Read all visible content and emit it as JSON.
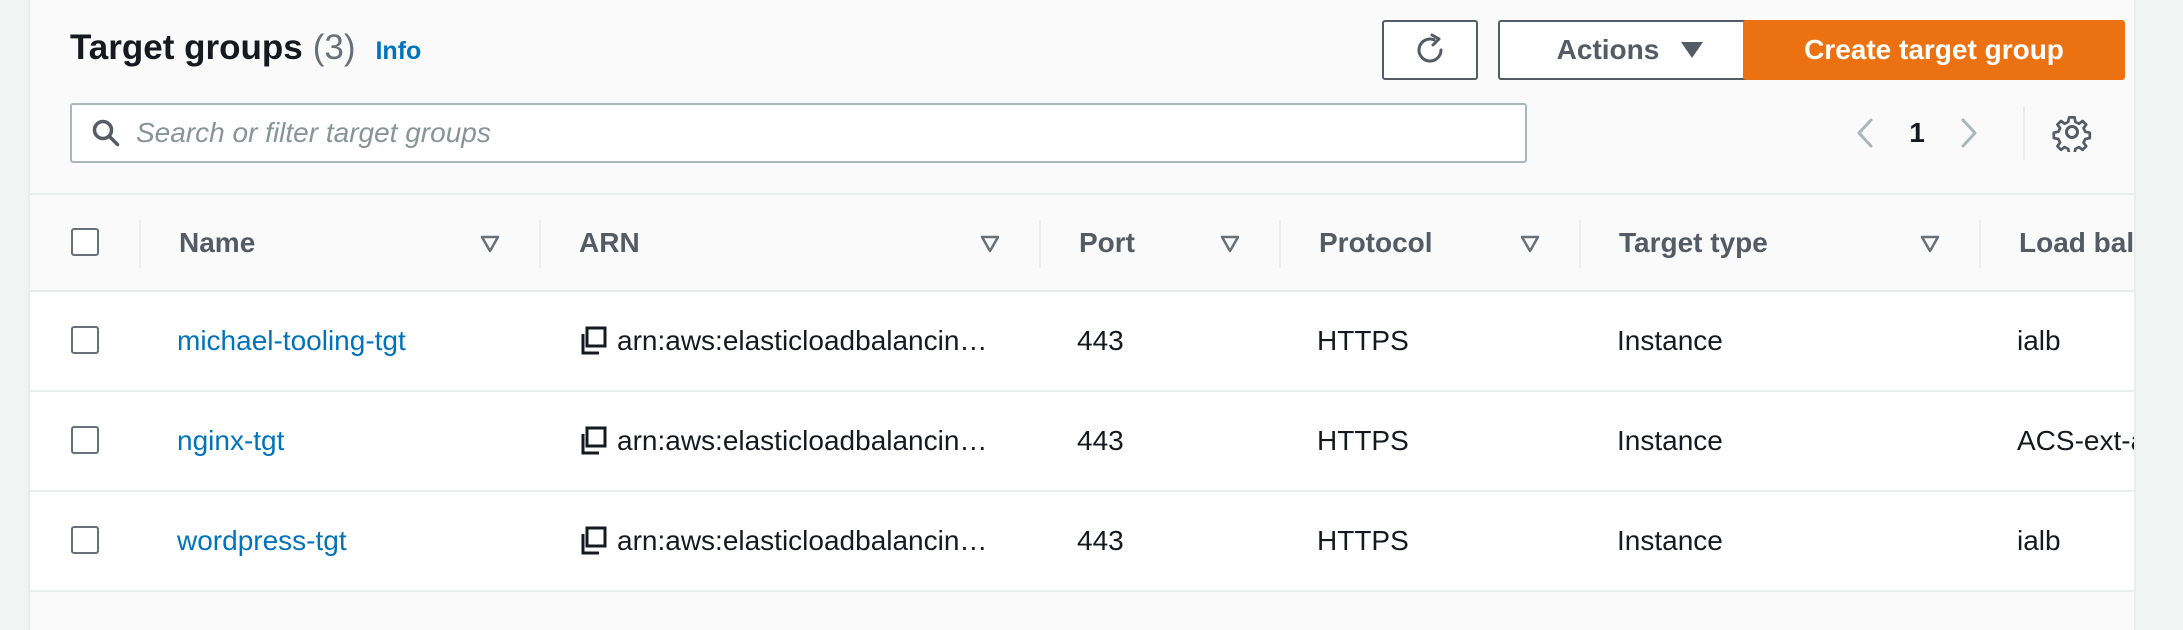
{
  "header": {
    "title": "Target groups",
    "count": "(3)",
    "info_link": "Info"
  },
  "toolbar": {
    "refresh_icon": "refresh-icon",
    "actions_label": "Actions",
    "create_label": "Create target group"
  },
  "search": {
    "placeholder": "Search or filter target groups",
    "value": ""
  },
  "pagination": {
    "current_page": "1"
  },
  "table": {
    "columns": [
      "Name",
      "ARN",
      "Port",
      "Protocol",
      "Target type",
      "Load bala"
    ],
    "rows": [
      {
        "name": "michael-tooling-tgt",
        "arn": "arn:aws:elasticloadbalancin…",
        "port": "443",
        "protocol": "HTTPS",
        "target_type": "Instance",
        "load_balancer": "ialb"
      },
      {
        "name": "nginx-tgt",
        "arn": "arn:aws:elasticloadbalancin…",
        "port": "443",
        "protocol": "HTTPS",
        "target_type": "Instance",
        "load_balancer": "ACS-ext-a"
      },
      {
        "name": "wordpress-tgt",
        "arn": "arn:aws:elasticloadbalancin…",
        "port": "443",
        "protocol": "HTTPS",
        "target_type": "Instance",
        "load_balancer": "ialb"
      }
    ]
  },
  "colors": {
    "primary_button": "#ec7211",
    "link": "#0073bb",
    "text": "#16191f",
    "muted": "#545b64"
  }
}
